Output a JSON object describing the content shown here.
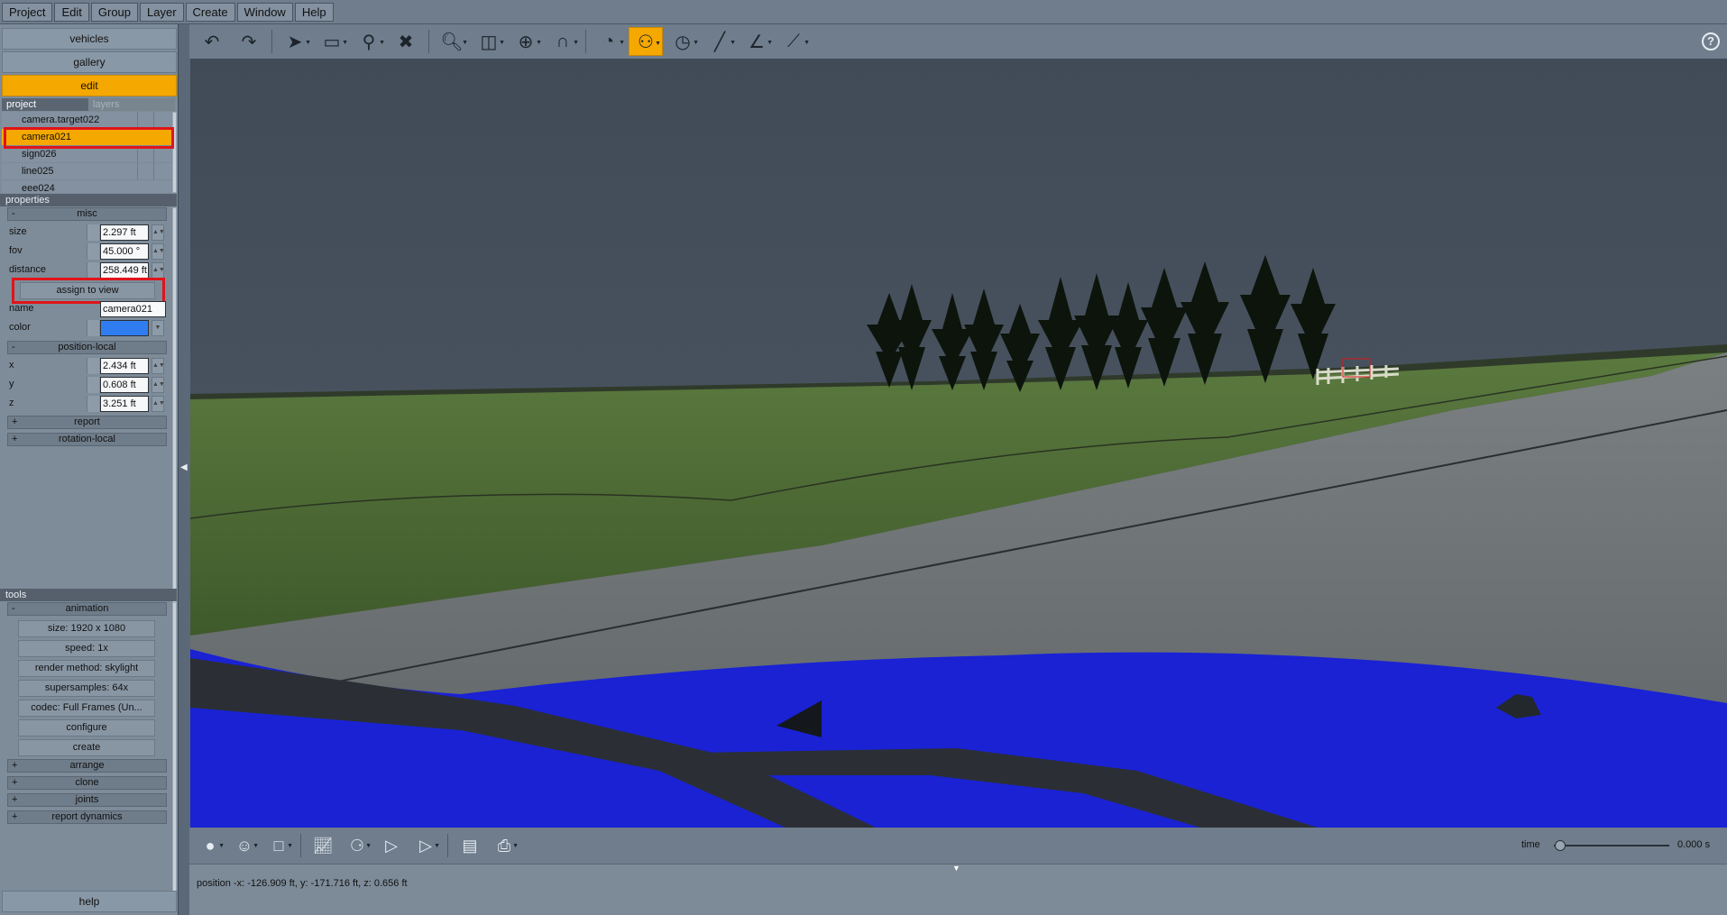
{
  "menubar": [
    "Project",
    "Edit",
    "Group",
    "Layer",
    "Create",
    "Window",
    "Help"
  ],
  "nav": {
    "vehicles": "vehicles",
    "gallery": "gallery",
    "edit": "edit"
  },
  "tabs": {
    "project": "project",
    "layers": "layers"
  },
  "tree": {
    "items": [
      "camera.target022",
      "camera021",
      "sign026",
      "line025",
      "eee024"
    ],
    "selected": "camera021"
  },
  "properties": {
    "header": "properties",
    "misc": {
      "label": "misc",
      "toggle": "-"
    },
    "size": {
      "label": "size",
      "value": "2.297 ft"
    },
    "fov": {
      "label": "fov",
      "value": "45.000 °"
    },
    "distance": {
      "label": "distance",
      "value": "258.449 ft"
    },
    "assign_button": "assign to view",
    "name": {
      "label": "name",
      "value": "camera021"
    },
    "color": {
      "label": "color",
      "value": "#2f7df0"
    },
    "position_local": {
      "label": "position-local",
      "toggle": "-"
    },
    "x": {
      "label": "x",
      "value": "2.434 ft"
    },
    "y": {
      "label": "y",
      "value": "0.608 ft"
    },
    "z": {
      "label": "z",
      "value": "3.251 ft"
    },
    "report": {
      "label": "report",
      "toggle": "+"
    },
    "rotation_local": {
      "label": "rotation-local",
      "toggle": "+"
    }
  },
  "tools": {
    "header": "tools",
    "animation": {
      "label": "animation",
      "toggle": "-"
    },
    "size": "size: 1920 x 1080",
    "speed": "speed: 1x",
    "render_method": "render method: skylight",
    "supersamples": "supersamples: 64x",
    "codec": "codec: Full Frames (Un...",
    "configure": "configure",
    "create": "create",
    "arrange": {
      "label": "arrange",
      "toggle": "+"
    },
    "clone": {
      "label": "clone",
      "toggle": "+"
    },
    "joints": {
      "label": "joints",
      "toggle": "+"
    },
    "report_dynamics": {
      "label": "report dynamics",
      "toggle": "+"
    }
  },
  "help_button": "help",
  "help_icon": "?",
  "timeline": {
    "label": "time",
    "value": "0.000 s"
  },
  "status": "position -x: -126.909 ft, y: -171.716 ft, z: 0.656 ft",
  "icons": [
    "undo-icon",
    "redo-icon",
    "select-arrow-icon",
    "rectangle-select-icon",
    "filter-icon",
    "delete-icon",
    "zoom-icon",
    "view-cube-icon",
    "target-icon",
    "magnet-icon",
    "speedometer-icon",
    "camera-reel-icon",
    "gauge-icon",
    "line-tool-icon",
    "measure-angle-icon",
    "ruler-icon"
  ],
  "colors": {
    "accent": "#f5a800",
    "highlight": "#e0141a",
    "panel": "#7e8c9a",
    "sky": "#46505c",
    "grass": "#4f6a35",
    "road": "#6d7274",
    "vehicle": "#1a24d8"
  }
}
